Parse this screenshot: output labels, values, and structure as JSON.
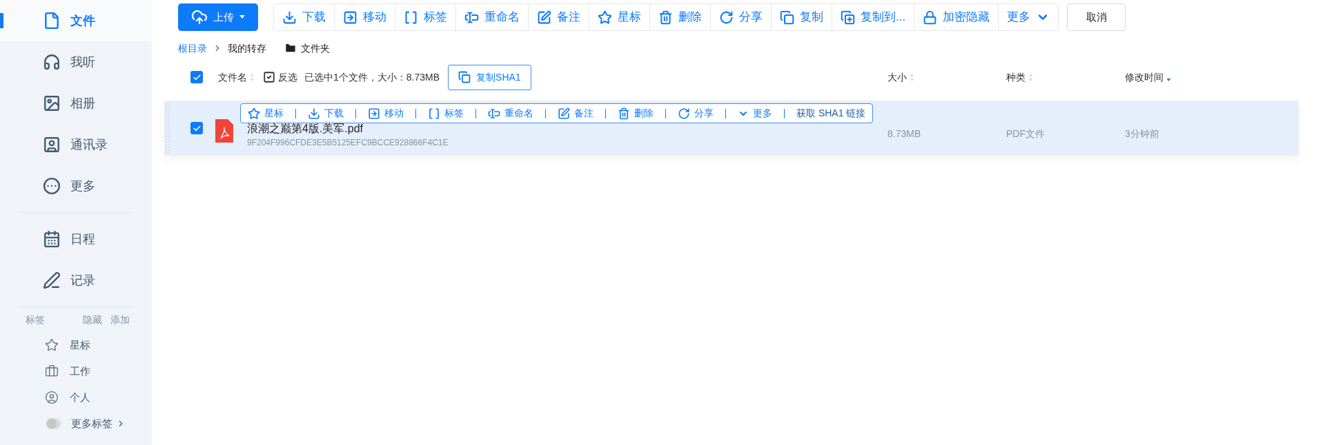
{
  "sidebar": {
    "nav": [
      {
        "label": "文件",
        "selected": true
      },
      {
        "label": "我听",
        "selected": false
      },
      {
        "label": "相册",
        "selected": false
      },
      {
        "label": "通讯录",
        "selected": false
      },
      {
        "label": "更多",
        "selected": false
      }
    ],
    "nav2": [
      {
        "label": "日程",
        "selected": false
      },
      {
        "label": "记录",
        "selected": false
      }
    ],
    "tags_header": {
      "title": "标签",
      "hide": "隐藏",
      "add": "添加"
    },
    "tags": [
      {
        "label": "星标"
      },
      {
        "label": "工作"
      },
      {
        "label": "个人"
      }
    ],
    "more_tags": "更多标签"
  },
  "toolbar": {
    "upload": "上传",
    "actions": [
      {
        "label": "下载",
        "kind": "action"
      },
      {
        "label": "移动",
        "kind": "action"
      },
      {
        "label": "标签",
        "kind": "action"
      },
      {
        "label": "重命名",
        "kind": "action"
      },
      {
        "label": "备注",
        "kind": "action"
      },
      {
        "label": "星标",
        "kind": "action"
      },
      {
        "label": "删除",
        "kind": "action"
      },
      {
        "label": "分享",
        "kind": "action"
      },
      {
        "label": "复制",
        "kind": "action"
      },
      {
        "label": "复制到...",
        "kind": "action"
      },
      {
        "label": "加密隐藏",
        "kind": "action"
      },
      {
        "label": "更多",
        "kind": "menu"
      }
    ],
    "cancel": "取消"
  },
  "breadcrumb": {
    "items": [
      "根目录",
      "我的转存"
    ],
    "new_folder": "文件夹"
  },
  "table": {
    "select_all": true,
    "invert": "反选",
    "summary": "已选中1个文件，大小：8.73MB",
    "copy_sha1": "复制SHA1",
    "columns": [
      {
        "label": "文件名",
        "sorted": false
      },
      {
        "label": "大小",
        "sorted": false
      },
      {
        "label": "种类",
        "sorted": false
      },
      {
        "label": "修改时间",
        "sorted": true
      }
    ],
    "rows": [
      {
        "checked": true,
        "selected": true,
        "name": "浪潮之巅第4版.美军.pdf",
        "hash": "9F204F996CFDE3E5B5125EFC9BCCE928866F4C1E",
        "size": "8.73MB",
        "type": "PDF文件",
        "modified": "3分钟前"
      }
    ]
  },
  "row_toolbar": [
    {
      "label": "星标",
      "kind": "action"
    },
    {
      "label": "下载",
      "kind": "action"
    },
    {
      "label": "移动",
      "kind": "action"
    },
    {
      "label": "标签",
      "kind": "action"
    },
    {
      "label": "重命名",
      "kind": "action"
    },
    {
      "label": "备注",
      "kind": "action"
    },
    {
      "label": "删除",
      "kind": "action"
    },
    {
      "label": "分享",
      "kind": "action"
    },
    {
      "label": "更多",
      "kind": "menu"
    },
    {
      "label": "获取 SHA1 链接",
      "kind": "link"
    }
  ]
}
